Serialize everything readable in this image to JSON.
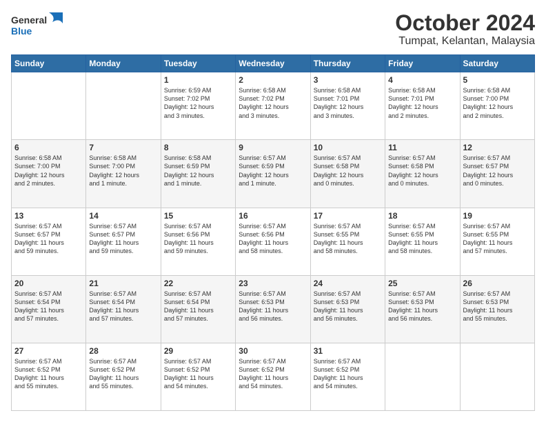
{
  "header": {
    "logo_line1": "General",
    "logo_line2": "Blue",
    "title": "October 2024",
    "subtitle": "Tumpat, Kelantan, Malaysia"
  },
  "days_of_week": [
    "Sunday",
    "Monday",
    "Tuesday",
    "Wednesday",
    "Thursday",
    "Friday",
    "Saturday"
  ],
  "weeks": [
    [
      {
        "day": "",
        "info": ""
      },
      {
        "day": "",
        "info": ""
      },
      {
        "day": "1",
        "info": "Sunrise: 6:59 AM\nSunset: 7:02 PM\nDaylight: 12 hours\nand 3 minutes."
      },
      {
        "day": "2",
        "info": "Sunrise: 6:58 AM\nSunset: 7:02 PM\nDaylight: 12 hours\nand 3 minutes."
      },
      {
        "day": "3",
        "info": "Sunrise: 6:58 AM\nSunset: 7:01 PM\nDaylight: 12 hours\nand 3 minutes."
      },
      {
        "day": "4",
        "info": "Sunrise: 6:58 AM\nSunset: 7:01 PM\nDaylight: 12 hours\nand 2 minutes."
      },
      {
        "day": "5",
        "info": "Sunrise: 6:58 AM\nSunset: 7:00 PM\nDaylight: 12 hours\nand 2 minutes."
      }
    ],
    [
      {
        "day": "6",
        "info": "Sunrise: 6:58 AM\nSunset: 7:00 PM\nDaylight: 12 hours\nand 2 minutes."
      },
      {
        "day": "7",
        "info": "Sunrise: 6:58 AM\nSunset: 7:00 PM\nDaylight: 12 hours\nand 1 minute."
      },
      {
        "day": "8",
        "info": "Sunrise: 6:58 AM\nSunset: 6:59 PM\nDaylight: 12 hours\nand 1 minute."
      },
      {
        "day": "9",
        "info": "Sunrise: 6:57 AM\nSunset: 6:59 PM\nDaylight: 12 hours\nand 1 minute."
      },
      {
        "day": "10",
        "info": "Sunrise: 6:57 AM\nSunset: 6:58 PM\nDaylight: 12 hours\nand 0 minutes."
      },
      {
        "day": "11",
        "info": "Sunrise: 6:57 AM\nSunset: 6:58 PM\nDaylight: 12 hours\nand 0 minutes."
      },
      {
        "day": "12",
        "info": "Sunrise: 6:57 AM\nSunset: 6:57 PM\nDaylight: 12 hours\nand 0 minutes."
      }
    ],
    [
      {
        "day": "13",
        "info": "Sunrise: 6:57 AM\nSunset: 6:57 PM\nDaylight: 11 hours\nand 59 minutes."
      },
      {
        "day": "14",
        "info": "Sunrise: 6:57 AM\nSunset: 6:57 PM\nDaylight: 11 hours\nand 59 minutes."
      },
      {
        "day": "15",
        "info": "Sunrise: 6:57 AM\nSunset: 6:56 PM\nDaylight: 11 hours\nand 59 minutes."
      },
      {
        "day": "16",
        "info": "Sunrise: 6:57 AM\nSunset: 6:56 PM\nDaylight: 11 hours\nand 58 minutes."
      },
      {
        "day": "17",
        "info": "Sunrise: 6:57 AM\nSunset: 6:55 PM\nDaylight: 11 hours\nand 58 minutes."
      },
      {
        "day": "18",
        "info": "Sunrise: 6:57 AM\nSunset: 6:55 PM\nDaylight: 11 hours\nand 58 minutes."
      },
      {
        "day": "19",
        "info": "Sunrise: 6:57 AM\nSunset: 6:55 PM\nDaylight: 11 hours\nand 57 minutes."
      }
    ],
    [
      {
        "day": "20",
        "info": "Sunrise: 6:57 AM\nSunset: 6:54 PM\nDaylight: 11 hours\nand 57 minutes."
      },
      {
        "day": "21",
        "info": "Sunrise: 6:57 AM\nSunset: 6:54 PM\nDaylight: 11 hours\nand 57 minutes."
      },
      {
        "day": "22",
        "info": "Sunrise: 6:57 AM\nSunset: 6:54 PM\nDaylight: 11 hours\nand 57 minutes."
      },
      {
        "day": "23",
        "info": "Sunrise: 6:57 AM\nSunset: 6:53 PM\nDaylight: 11 hours\nand 56 minutes."
      },
      {
        "day": "24",
        "info": "Sunrise: 6:57 AM\nSunset: 6:53 PM\nDaylight: 11 hours\nand 56 minutes."
      },
      {
        "day": "25",
        "info": "Sunrise: 6:57 AM\nSunset: 6:53 PM\nDaylight: 11 hours\nand 56 minutes."
      },
      {
        "day": "26",
        "info": "Sunrise: 6:57 AM\nSunset: 6:53 PM\nDaylight: 11 hours\nand 55 minutes."
      }
    ],
    [
      {
        "day": "27",
        "info": "Sunrise: 6:57 AM\nSunset: 6:52 PM\nDaylight: 11 hours\nand 55 minutes."
      },
      {
        "day": "28",
        "info": "Sunrise: 6:57 AM\nSunset: 6:52 PM\nDaylight: 11 hours\nand 55 minutes."
      },
      {
        "day": "29",
        "info": "Sunrise: 6:57 AM\nSunset: 6:52 PM\nDaylight: 11 hours\nand 54 minutes."
      },
      {
        "day": "30",
        "info": "Sunrise: 6:57 AM\nSunset: 6:52 PM\nDaylight: 11 hours\nand 54 minutes."
      },
      {
        "day": "31",
        "info": "Sunrise: 6:57 AM\nSunset: 6:52 PM\nDaylight: 11 hours\nand 54 minutes."
      },
      {
        "day": "",
        "info": ""
      },
      {
        "day": "",
        "info": ""
      }
    ]
  ]
}
